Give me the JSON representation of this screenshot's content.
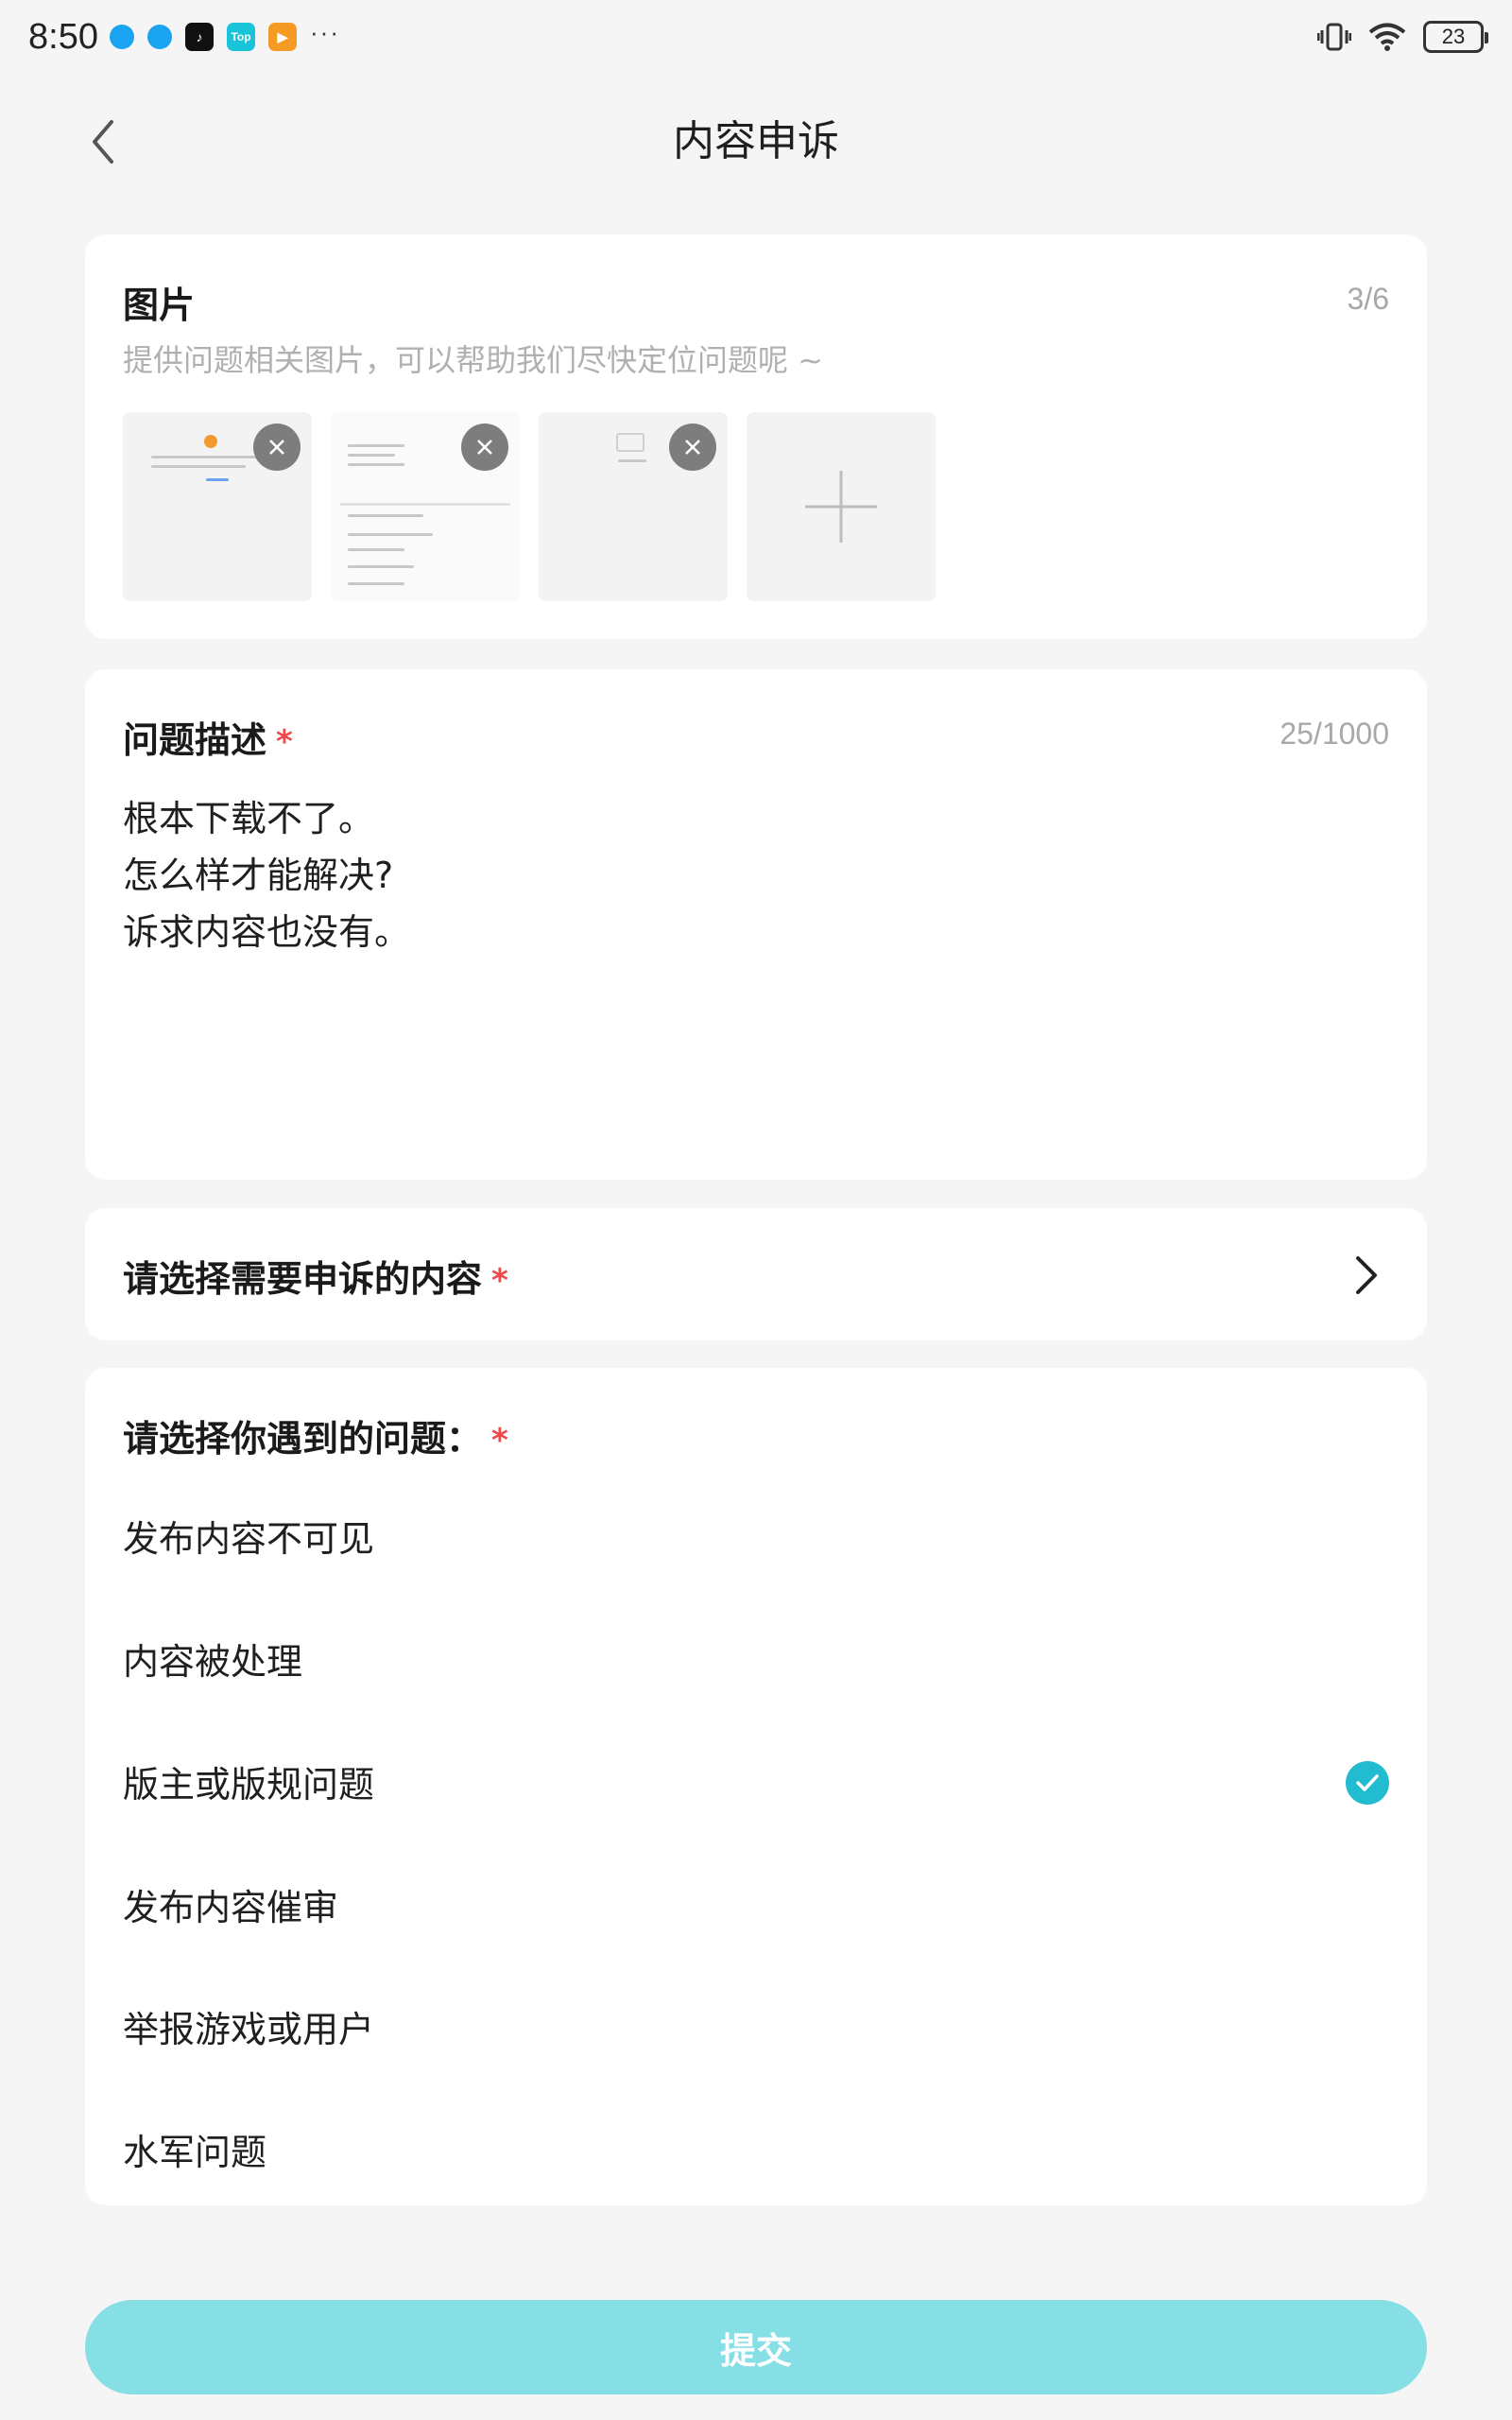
{
  "status_bar": {
    "time": "8:50",
    "battery": "23",
    "app_icons": [
      "bird-app-icon",
      "bird-app-icon",
      "tiktok-icon",
      "top-app-icon",
      "play-app-icon"
    ],
    "top_label": "Top"
  },
  "header": {
    "title": "内容申诉"
  },
  "images": {
    "title": "图片",
    "count": "3/6",
    "hint": "提供问题相关图片，可以帮助我们尽快定位问题呢 ~"
  },
  "description": {
    "title": "问题描述",
    "required": "*",
    "count": "25/1000",
    "lines": [
      "根本下载不了。",
      "怎么样才能解决?",
      "诉求内容也没有。"
    ]
  },
  "select_content": {
    "label": "请选择需要申诉的内容",
    "required": "*"
  },
  "problem": {
    "title": "请选择你遇到的问题：",
    "required": "*",
    "options": [
      {
        "label": "发布内容不可见",
        "selected": false
      },
      {
        "label": "内容被处理",
        "selected": false
      },
      {
        "label": "版主或版规问题",
        "selected": true
      },
      {
        "label": "发布内容催审",
        "selected": false
      },
      {
        "label": "举报游戏或用户",
        "selected": false
      },
      {
        "label": "水军问题",
        "selected": false
      }
    ]
  },
  "submit": {
    "label": "提交"
  },
  "colors": {
    "accent": "#21bcd0",
    "submit_bg": "#86dfe5",
    "required": "#f04848",
    "background": "#f5f5f6"
  }
}
